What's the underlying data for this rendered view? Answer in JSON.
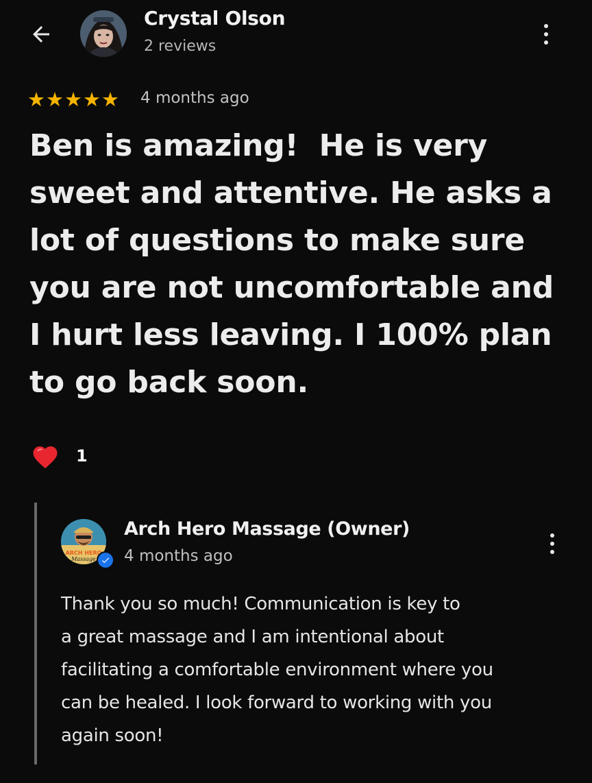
{
  "review": {
    "author_name": "Crystal Olson",
    "author_review_count": "2 reviews",
    "rating": 5,
    "stars": [
      "★",
      "★",
      "★",
      "★",
      "★"
    ],
    "date": "4 months ago",
    "text": "Ben is amazing!  He is very\nsweet and attentive. He asks a\nlot of questions to make sure\nyou are not uncomfortable and\nI hurt less leaving. I 100% plan\nto go back soon.",
    "like_count": "1"
  },
  "owner_reply": {
    "name": "Arch Hero Massage (Owner)",
    "date": "4 months ago",
    "logo_text": "ARCH HERO Massage",
    "text": "Thank you so much! Communication is key to\na great massage and I am intentional about\nfacilitating a comfortable environment where you\ncan be healed. I look forward to working with you\nagain soon!"
  },
  "icons": {
    "back": "arrow-back-icon",
    "menu": "more-vert-icon",
    "star": "star-icon",
    "heart": "heart-icon",
    "verified": "verified-check-icon"
  },
  "colors": {
    "background": "#0b0b0b",
    "star": "#f5b400",
    "heart": "#e8262f",
    "verified": "#1a73e8",
    "reply_bar": "#6a6a6a"
  }
}
